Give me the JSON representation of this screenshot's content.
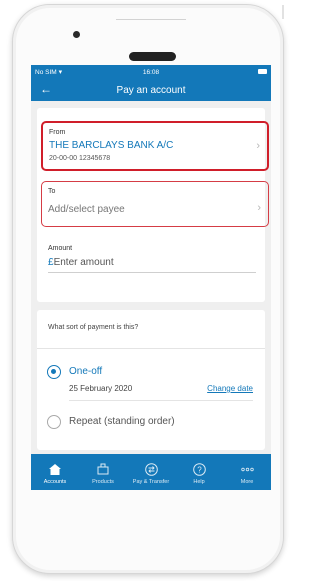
{
  "status_bar": {
    "carrier": "No SIM",
    "time": "16:08"
  },
  "header": {
    "title": "Pay an account",
    "back_icon": "back-arrow-icon"
  },
  "from": {
    "label": "From",
    "account_name": "THE BARCLAYS BANK A/C",
    "account_details": "20-00-00  12345678"
  },
  "to": {
    "label": "To",
    "placeholder": "Add/select payee"
  },
  "amount": {
    "label": "Amount",
    "currency": "£",
    "placeholder": "Enter amount"
  },
  "payment_type": {
    "question": "What sort of payment is this?",
    "options": [
      {
        "label": "One-off",
        "selected": true
      },
      {
        "label": "Repeat (standing order)",
        "selected": false
      }
    ],
    "date": "25 February 2020",
    "change_date_label": "Change date"
  },
  "tabbar": {
    "items": [
      {
        "label": "Accounts",
        "icon": "home-icon"
      },
      {
        "label": "Products",
        "icon": "products-icon"
      },
      {
        "label": "Pay & Transfer",
        "icon": "transfer-icon"
      },
      {
        "label": "Help",
        "icon": "help-icon"
      },
      {
        "label": "More",
        "icon": "more-icon"
      }
    ]
  },
  "colors": {
    "brand": "#1378b9",
    "highlight": "#d01e2a"
  }
}
